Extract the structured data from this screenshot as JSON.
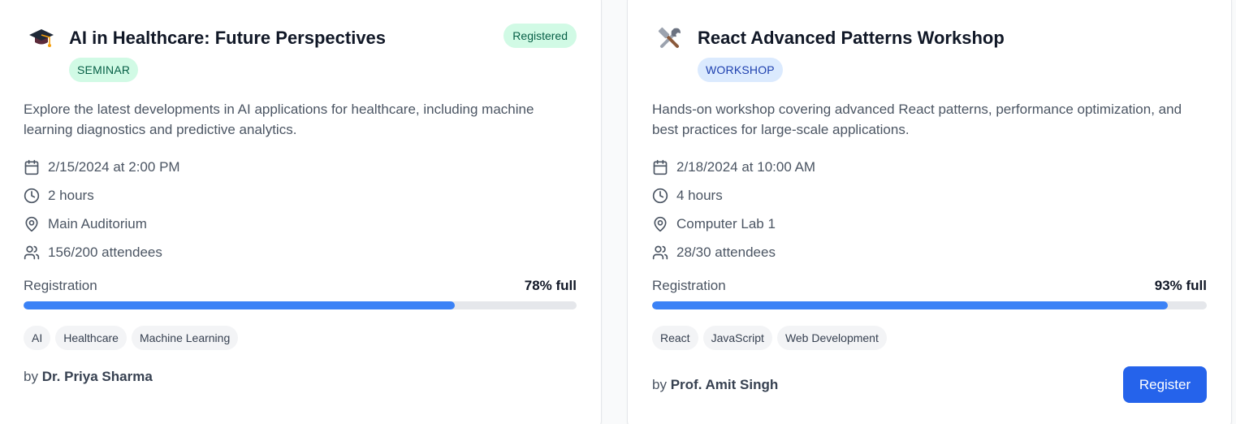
{
  "events": [
    {
      "icon": "graduation-cap-icon",
      "title": "AI in Healthcare: Future Perspectives",
      "type": "SEMINAR",
      "status": "Registered",
      "description": "Explore the latest developments in AI applications for healthcare, including machine learning diagnostics and predictive analytics.",
      "datetime": "2/15/2024 at 2:00 PM",
      "duration": "2 hours",
      "location": "Main Auditorium",
      "attendees": "156/200 attendees",
      "registration_label": "Registration",
      "registration_pct_label": "78% full",
      "registration_fill": 0.78,
      "tags": [
        "AI",
        "Healthcare",
        "Machine Learning"
      ],
      "author_prefix": "by",
      "author": "Dr. Priya Sharma"
    },
    {
      "icon": "hammer-wrench-icon",
      "title": "React Advanced Patterns Workshop",
      "type": "WORKSHOP",
      "description": "Hands-on workshop covering advanced React patterns, performance optimization, and best practices for large-scale applications.",
      "datetime": "2/18/2024 at 10:00 AM",
      "duration": "4 hours",
      "location": "Computer Lab 1",
      "attendees": "28/30 attendees",
      "registration_label": "Registration",
      "registration_pct_label": "93% full",
      "registration_fill": 0.93,
      "tags": [
        "React",
        "JavaScript",
        "Web Development"
      ],
      "author_prefix": "by",
      "author": "Prof. Amit Singh",
      "register_label": "Register"
    }
  ],
  "colors": {
    "accent": "#2563eb",
    "progress": "#3b82f6",
    "seminar_badge_bg": "#d1fae5",
    "workshop_badge_bg": "#dbeafe"
  }
}
